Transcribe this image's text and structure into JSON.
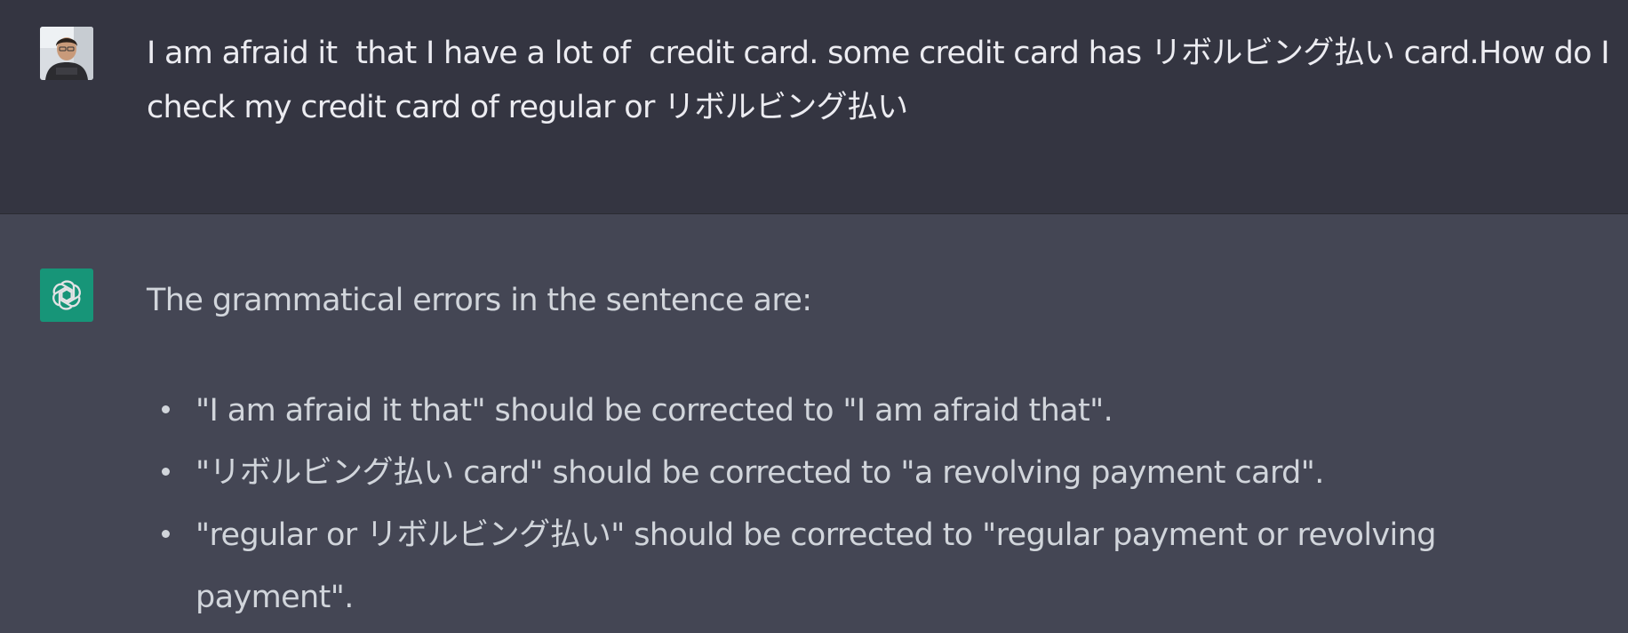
{
  "user_message": {
    "text": "I am afraid it  that I have a lot of  credit card. some credit card has リボルビング払い card.How do I check my credit card of regular or リボルビング払い"
  },
  "assistant_message": {
    "intro": "The grammatical errors in the sentence are:",
    "bullets": [
      "\"I am afraid it that\" should be corrected to \"I am afraid that\".",
      "\"リボルビング払い card\" should be corrected to \"a revolving payment card\".",
      "\"regular or リボルビング払い\" should be corrected to \"regular payment or revolving payment\"."
    ]
  },
  "icons": {
    "user_avatar": "user-avatar-photo",
    "assistant_avatar": "openai-logo-icon"
  },
  "colors": {
    "user_row_bg": "#343541",
    "assistant_row_bg": "#444654",
    "assistant_avatar_bg": "#10a37f"
  }
}
